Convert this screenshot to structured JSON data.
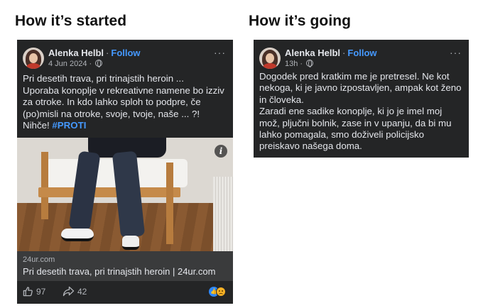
{
  "headings": {
    "left": "How it’s started",
    "right": "How it’s going"
  },
  "post_left": {
    "author": "Alenka Helbl",
    "follow_label": "Follow",
    "date": "4 Jun 2024 ·",
    "more": "···",
    "body_line1": "Pri desetih trava, pri trinajstih heroin ...",
    "body_line2": "Uporaba konoplje v rekreativne namene bo izziv za otroke. In kdo lahko sploh to podpre, če (po)misli na otroke, svoje, tvoje, naše ... ?!",
    "body_line3_text": "Nihče! ",
    "hashtag": "#PROTI",
    "image_info": "i",
    "link_domain": "24ur.com",
    "link_title": "Pri desetih trava, pri trinajstih heroin | 24ur.com",
    "likes": "97",
    "shares": "42"
  },
  "post_right": {
    "author": "Alenka Helbl",
    "follow_label": "Follow",
    "date": "13h ·",
    "more": "···",
    "body_para1": "Dogodek pred kratkim me je pretresel. Ne kot nekoga, ki je javno izpostavljen, ampak kot ženo in človeka.",
    "body_para2": "Zaradi ene sadike konoplje, ki jo je imel moj mož, pljučni bolnik, zase in v upanju, da bi mu lahko pomagala, smo doživeli policijsko preiskavo našega doma."
  },
  "colors": {
    "card_bg": "#242526",
    "link_blue": "#4599ff",
    "text": "#e4e6eb",
    "muted": "#b0b3b8"
  }
}
